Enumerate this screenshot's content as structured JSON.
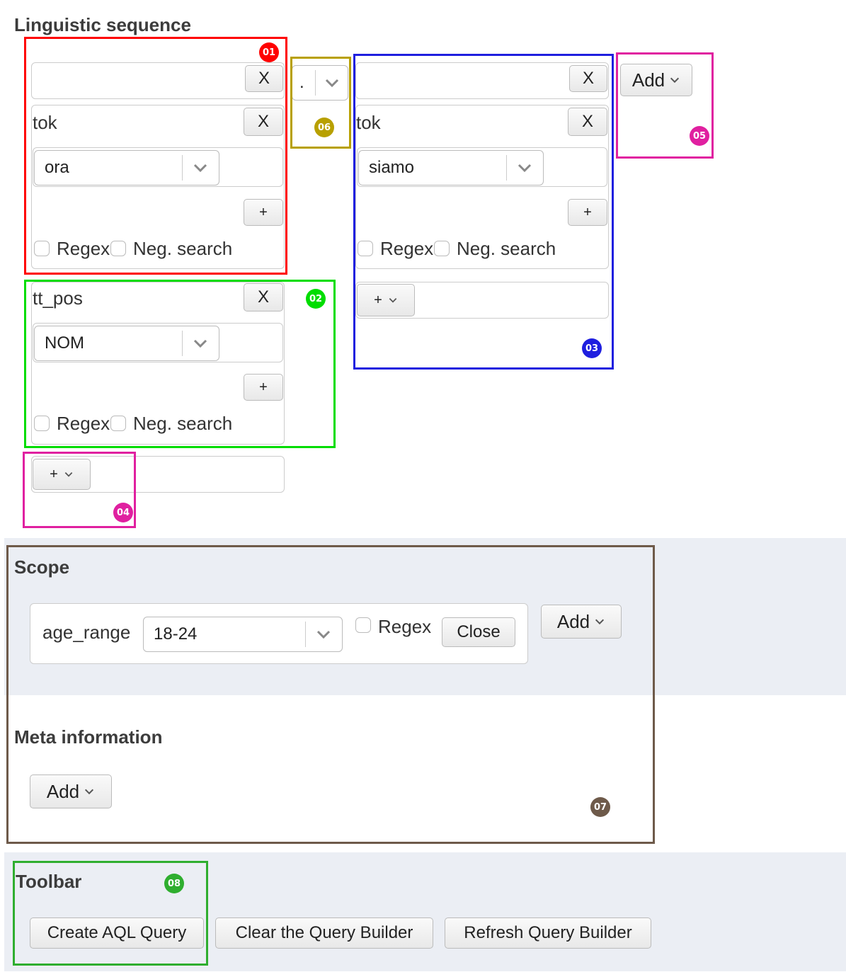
{
  "linguistic": {
    "title": "Linguistic sequence",
    "token1": {
      "remove_label": "X",
      "attr1": {
        "name": "tok",
        "remove_label": "X",
        "value": "ora",
        "add_value_label": "+",
        "regex_label": "Regex",
        "neg_label": "Neg. search"
      },
      "attr2": {
        "name": "tt_pos",
        "remove_label": "X",
        "value": "NOM",
        "add_value_label": "+",
        "regex_label": "Regex",
        "neg_label": "Neg. search"
      },
      "add_attr_label": "+"
    },
    "operator": {
      "value": "."
    },
    "token2": {
      "remove_label": "X",
      "attr1": {
        "name": "tok",
        "remove_label": "X",
        "value": "siamo",
        "add_value_label": "+",
        "regex_label": "Regex",
        "neg_label": "Neg. search"
      },
      "add_attr_label": "+"
    },
    "add_token_label": "Add"
  },
  "scope": {
    "title": "Scope",
    "item": {
      "name": "age_range",
      "value": "18-24",
      "regex_label": "Regex",
      "close_label": "Close"
    },
    "add_label": "Add"
  },
  "meta": {
    "title": "Meta information",
    "add_label": "Add"
  },
  "toolbar": {
    "title": "Toolbar",
    "buttons": [
      "Create AQL Query",
      "Clear the Query Builder",
      "Refresh Query Builder"
    ]
  },
  "annotations": {
    "markers": [
      "01",
      "02",
      "03",
      "04",
      "05",
      "06",
      "07",
      "08"
    ],
    "colors": {
      "01": "#ff0000",
      "02": "#00dd00",
      "03": "#1f1fdf",
      "04": "#e020a0",
      "05": "#e020a0",
      "06": "#b8a000",
      "07": "#6e5a4a",
      "08": "#2fae2f"
    }
  },
  "colors": {
    "band": "#ebeef4",
    "button_border": "#bbbbbb"
  }
}
